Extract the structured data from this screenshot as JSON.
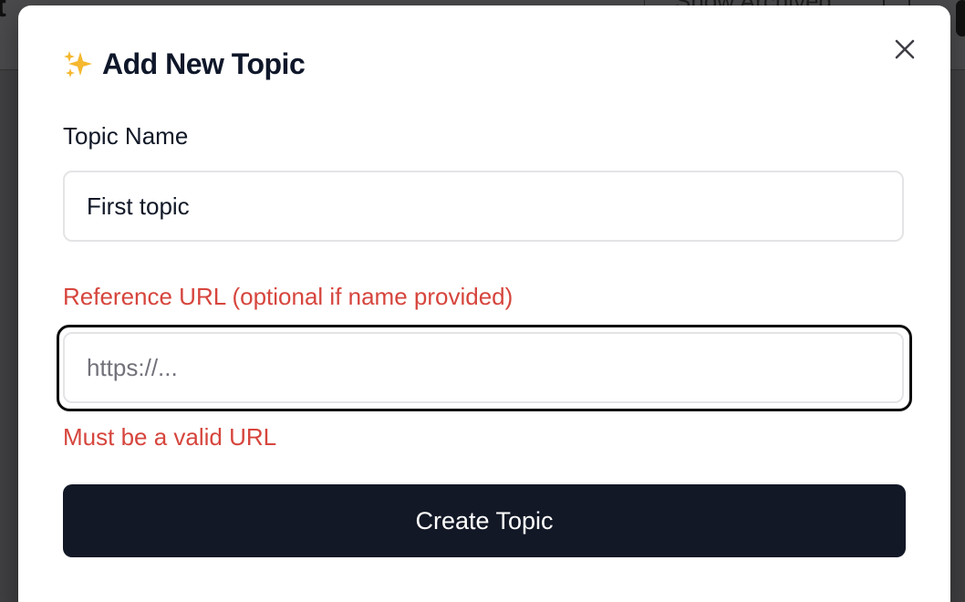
{
  "background": {
    "title_fragment": "it",
    "show_archived_label": "Show Archived"
  },
  "modal": {
    "title_icon": "sparkles-icon",
    "title": "Add New Topic",
    "close_icon": "close-icon",
    "topic_name": {
      "label": "Topic Name",
      "value": "First topic"
    },
    "reference_url": {
      "label": "Reference URL (optional if name provided)",
      "value": "",
      "placeholder": "https://...",
      "error": "Must be a valid URL"
    },
    "submit_label": "Create Topic"
  },
  "colors": {
    "error": "#d6453d",
    "primary_button": "#121826",
    "title": "#0f172a"
  }
}
